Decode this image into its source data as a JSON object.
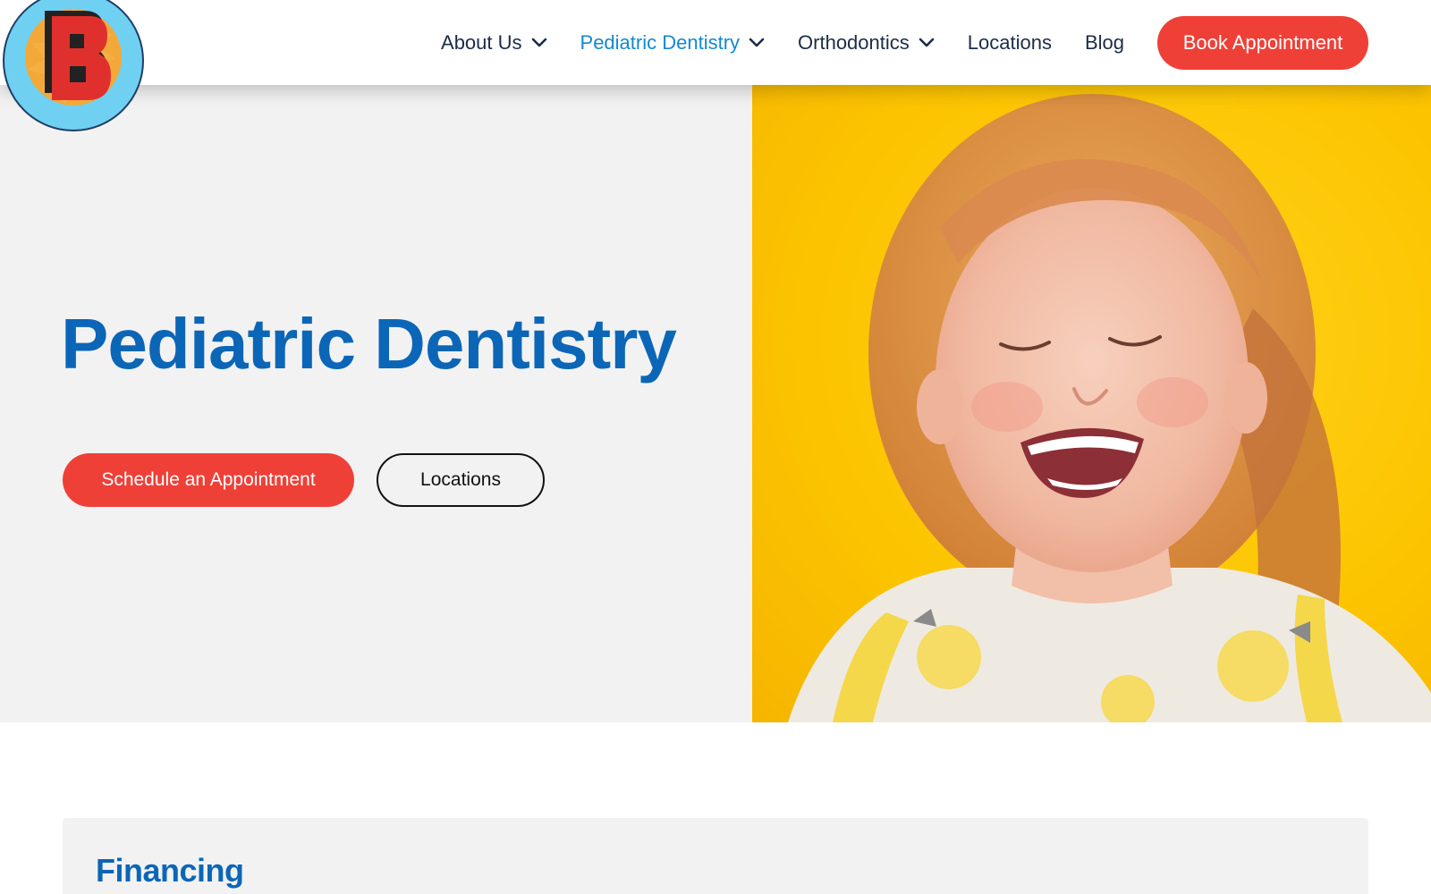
{
  "header": {
    "logo_alt": "B",
    "nav": [
      {
        "label": "About Us",
        "has_dropdown": true,
        "active": false
      },
      {
        "label": "Pediatric Dentistry",
        "has_dropdown": true,
        "active": true
      },
      {
        "label": "Orthodontics",
        "has_dropdown": true,
        "active": false
      },
      {
        "label": "Locations",
        "has_dropdown": false,
        "active": false
      },
      {
        "label": "Blog",
        "has_dropdown": false,
        "active": false
      }
    ],
    "cta_label": "Book Appointment"
  },
  "hero": {
    "title": "Pediatric Dentistry",
    "primary_button": "Schedule an Appointment",
    "secondary_button": "Locations",
    "image_description_icon": "smiling-child-photo"
  },
  "financing": {
    "title": "Financing"
  },
  "colors": {
    "brand_blue": "#0c66b7",
    "active_nav_blue": "#1488d0",
    "cta_red": "#ef4038",
    "hero_yellow": "#fcc400",
    "hero_gray": "#f2f2f2"
  }
}
